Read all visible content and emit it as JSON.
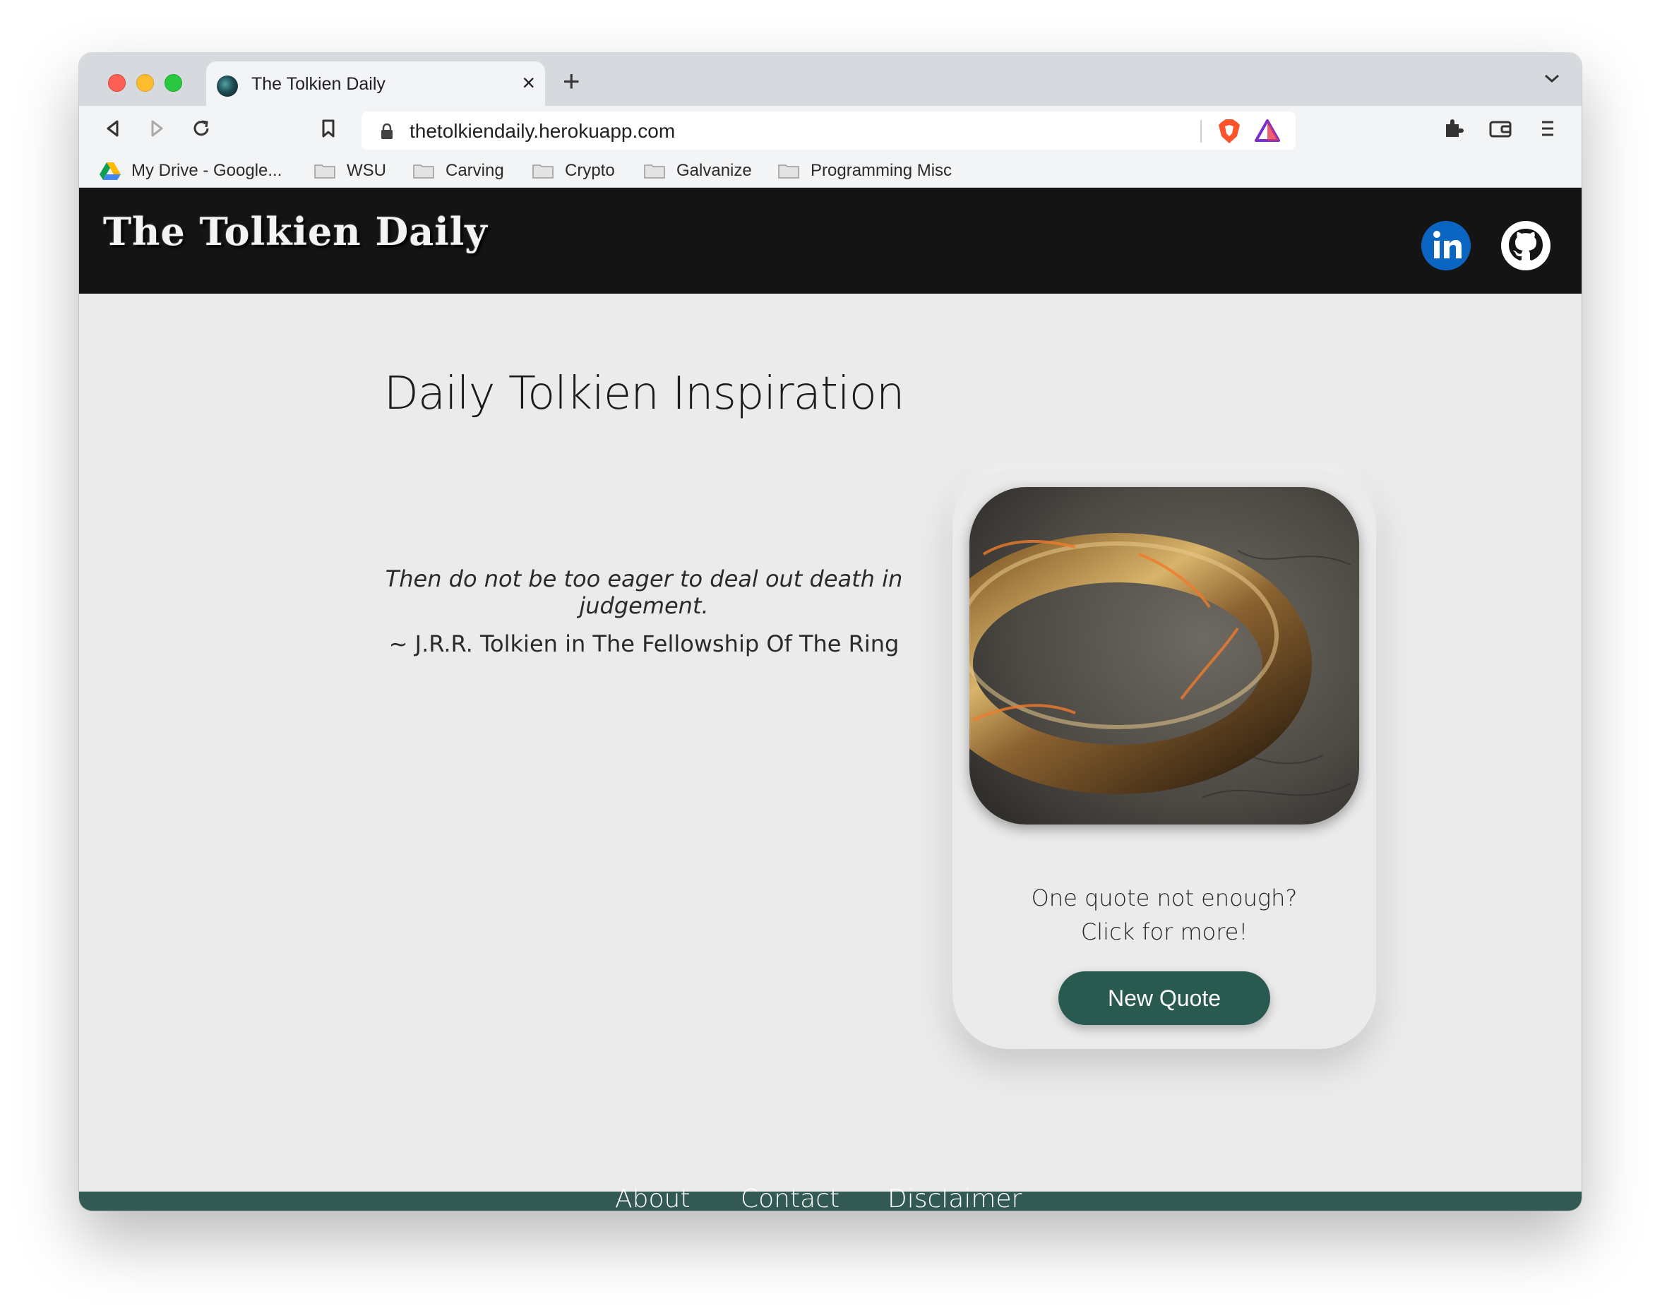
{
  "browser": {
    "tab_title": "The Tolkien Daily",
    "url": "thetolkiendaily.herokuapp.com",
    "bookmarks": [
      "My Drive - Google...",
      "WSU",
      "Carving",
      "Crypto",
      "Galvanize",
      "Programming Misc"
    ]
  },
  "site": {
    "title": "The Tolkien Daily",
    "heading": "Daily Tolkien Inspiration",
    "quote_line1": "Then do not be too eager to deal out death in",
    "quote_line2": "judgement.",
    "attribution": "~ J.R.R. Tolkien in The Fellowship Of The Ring",
    "card_prompt_line1": "One quote not enough?",
    "card_prompt_line2": "Click for more!",
    "new_quote_label": "New Quote",
    "footer_links": [
      "About",
      "Contact",
      "Disclaimer"
    ],
    "social_icons": [
      "linkedin-icon",
      "github-icon"
    ]
  },
  "colors": {
    "header_bg": "#141414",
    "footer_bg": "#325954",
    "button_bg": "#285a50",
    "page_bg": "#ebebeb",
    "linkedin_blue": "#0a66c2"
  }
}
